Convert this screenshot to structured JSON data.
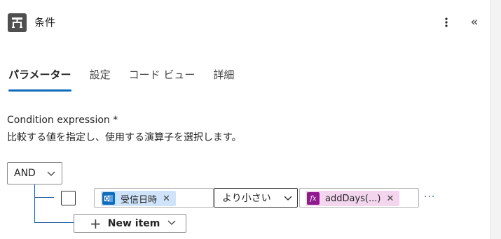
{
  "header": {
    "title": "条件",
    "icon": "condition-icon",
    "more_icon": "more-vertical-icon",
    "collapse_icon": "double-chevron-left-icon",
    "collapse_glyph": "«"
  },
  "tabs": [
    {
      "label": "パラメーター",
      "active": true
    },
    {
      "label": "設定",
      "active": false
    },
    {
      "label": "コード ビュー",
      "active": false
    },
    {
      "label": "詳細",
      "active": false
    }
  ],
  "condition": {
    "label": "Condition expression",
    "required_mark": "*",
    "description": "比較する値を指定し、使用する演算子を選択します。",
    "group_operator": "AND",
    "row": {
      "left_token": {
        "label": "受信日時",
        "icon": "outlook-icon",
        "badge_color": "#0f6cbd"
      },
      "operator": "より小さい",
      "right_token": {
        "label": "addDays(...)",
        "icon": "fx-icon",
        "badge_color": "#8f1a8f",
        "badge_text": "fx"
      },
      "more": "···"
    },
    "new_item_label": "New item"
  },
  "colors": {
    "accent": "#0f6cbd",
    "outlook_token_bg": "#cfe4fa",
    "expression_token_bg": "#f3d6ee"
  }
}
